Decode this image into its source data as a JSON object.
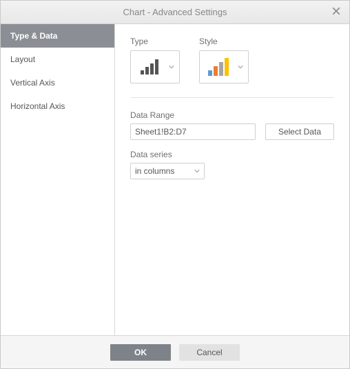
{
  "dialog": {
    "title": "Chart - Advanced Settings"
  },
  "sidebar": {
    "items": [
      {
        "label": "Type & Data",
        "active": true
      },
      {
        "label": "Layout",
        "active": false
      },
      {
        "label": "Vertical Axis",
        "active": false
      },
      {
        "label": "Horizontal Axis",
        "active": false
      }
    ]
  },
  "panel": {
    "type_label": "Type",
    "style_label": "Style",
    "data_range_label": "Data Range",
    "data_range_value": "Sheet1!B2:D7",
    "select_data_label": "Select Data",
    "data_series_label": "Data series",
    "data_series_value": "in columns"
  },
  "style_colors": {
    "bar1": "#5b9bd5",
    "bar2": "#ed7d31",
    "bar3": "#a5a5a5",
    "bar4": "#ffc000"
  },
  "footer": {
    "ok": "OK",
    "cancel": "Cancel"
  }
}
